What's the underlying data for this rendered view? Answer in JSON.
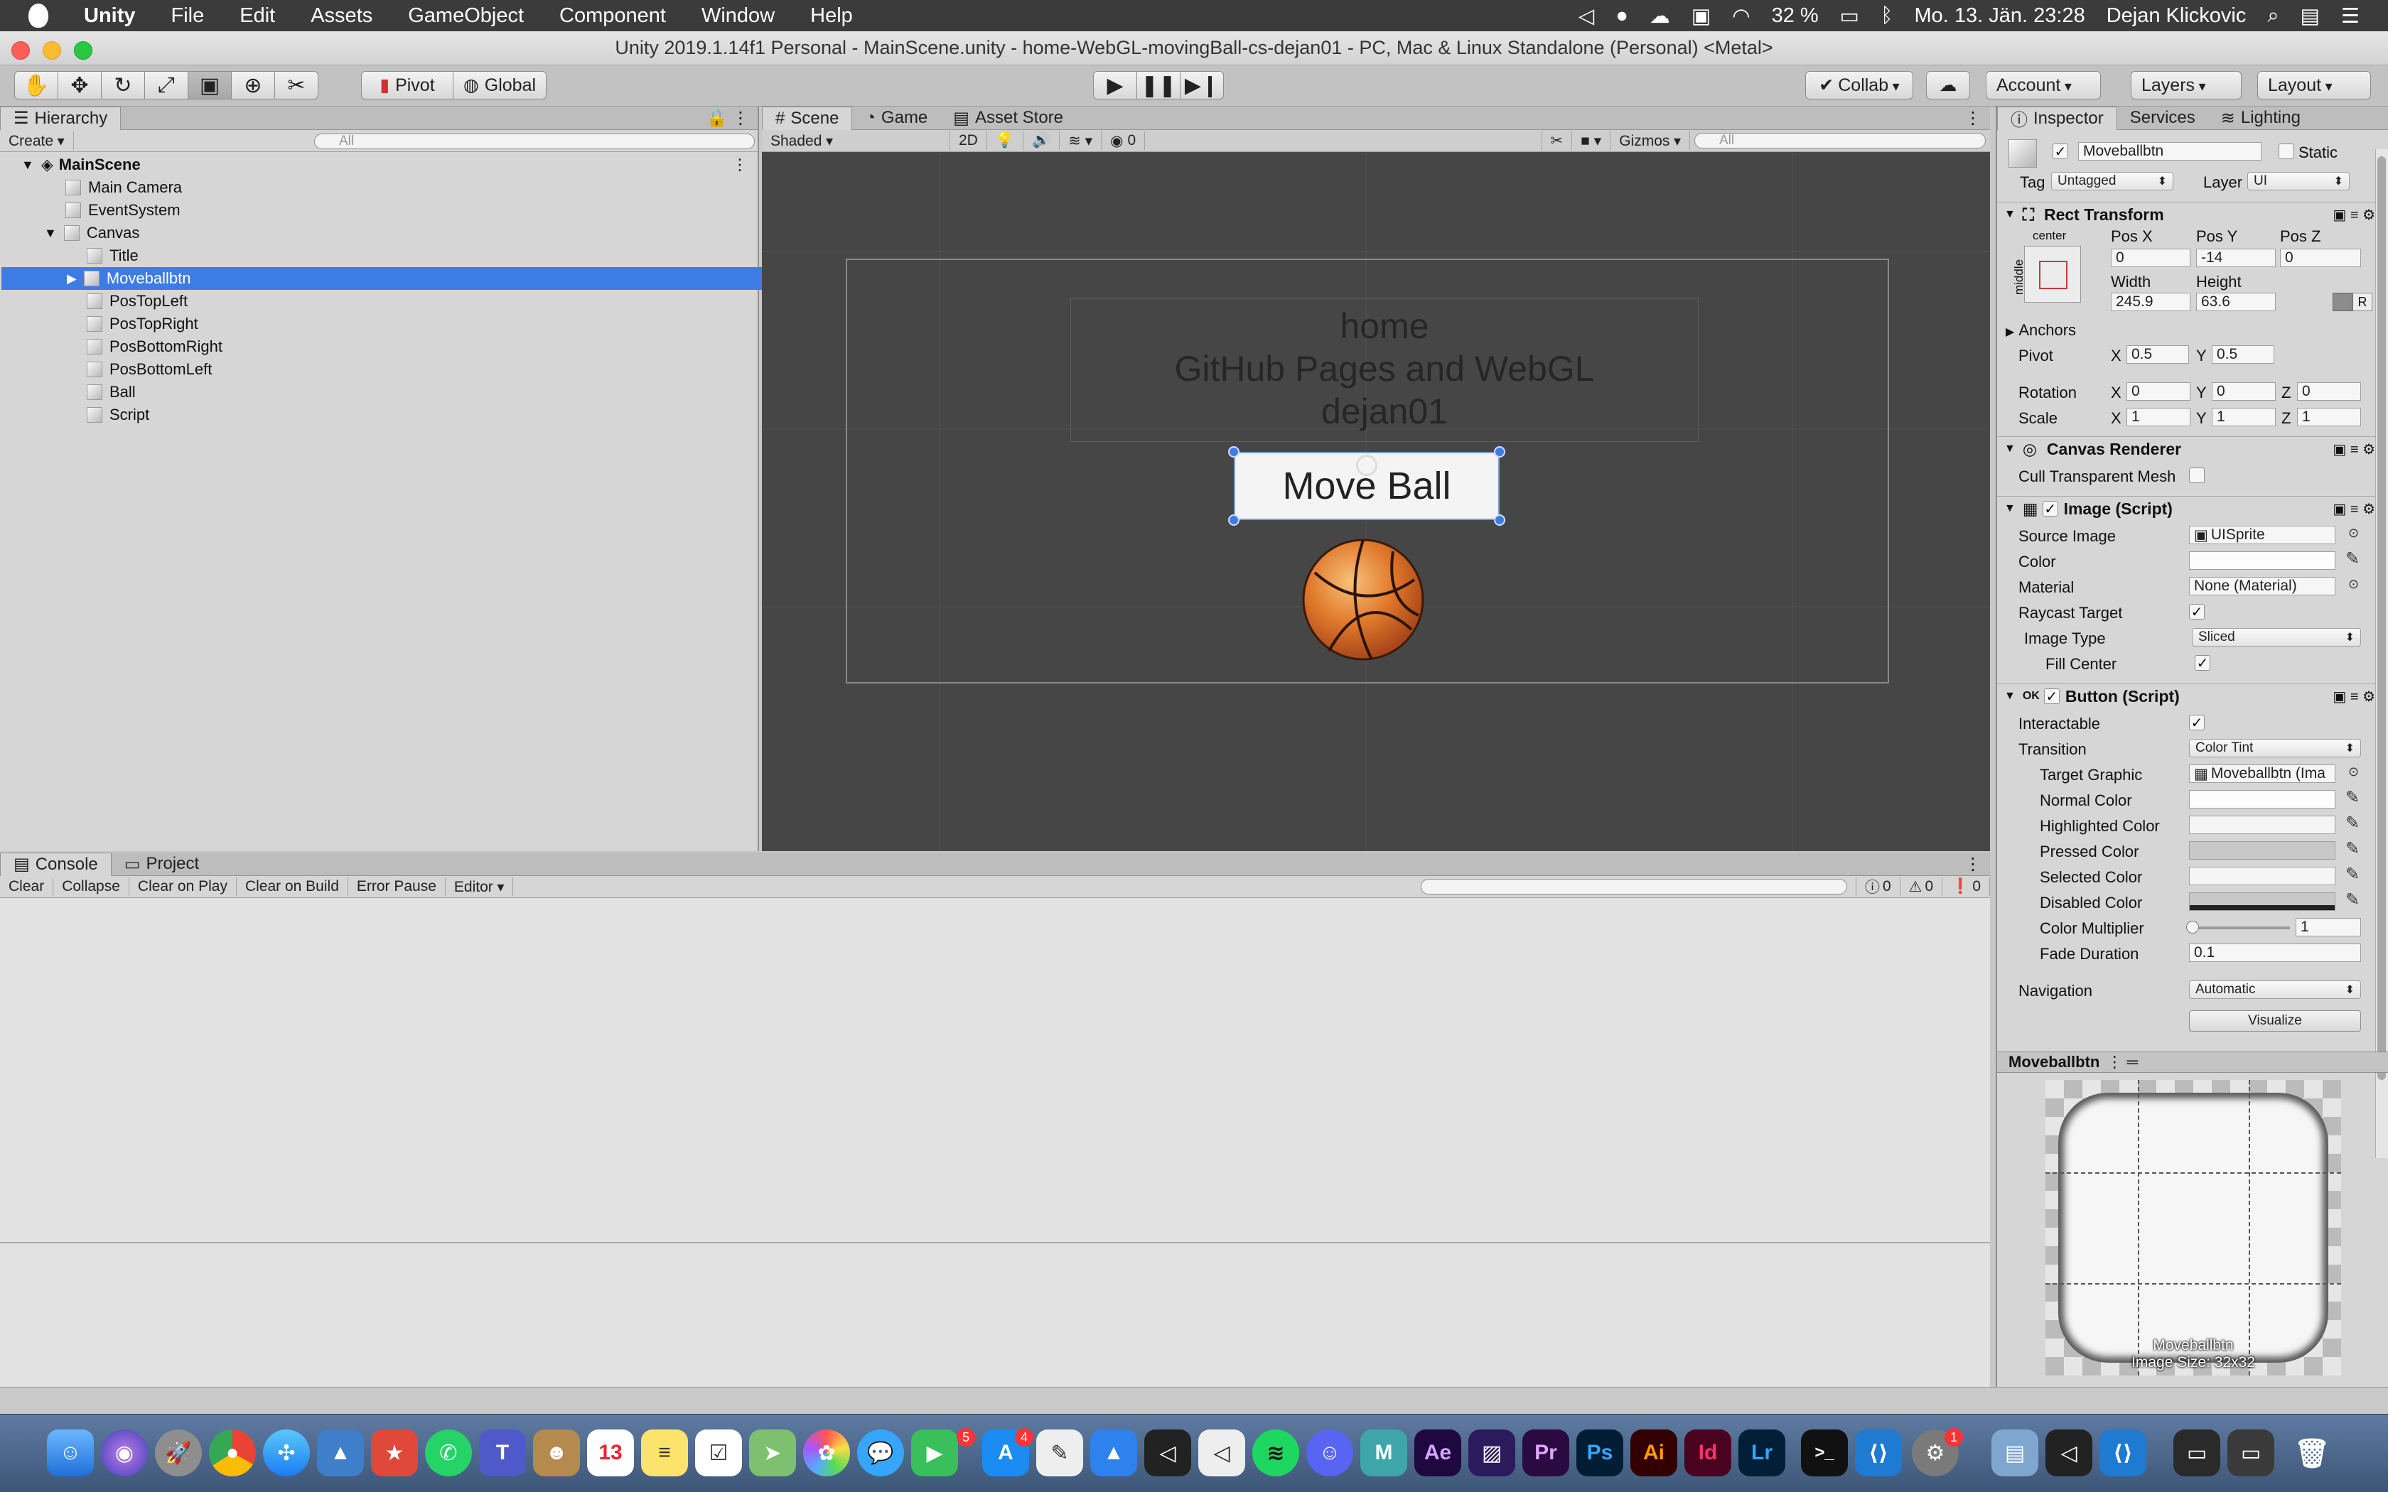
{
  "menubar": {
    "app": "Unity",
    "items": [
      "File",
      "Edit",
      "Assets",
      "GameObject",
      "Component",
      "Window",
      "Help"
    ],
    "battery": "32 %",
    "clock": "Mo. 13. Jän. 23:28",
    "user": "Dejan Klickovic"
  },
  "window": {
    "title": "Unity 2019.1.14f1 Personal - MainScene.unity - home-WebGL-movingBall-cs-dejan01 - PC, Mac & Linux Standalone (Personal) <Metal>"
  },
  "toolbar": {
    "pivot": "Pivot",
    "global": "Global",
    "collab": "Collab",
    "account": "Account",
    "layers": "Layers",
    "layout": "Layout"
  },
  "hierarchy": {
    "tab": "Hierarchy",
    "create": "Create",
    "search_placeholder": "All",
    "scene": "MainScene",
    "items": [
      "Main Camera",
      "EventSystem",
      "Canvas",
      "Title",
      "Moveballbtn",
      "PosTopLeft",
      "PosTopRight",
      "PosBottomRight",
      "PosBottomLeft",
      "Ball",
      "Script"
    ]
  },
  "scene": {
    "tabs": [
      "Scene",
      "Game",
      "Asset Store"
    ],
    "shading": "Shaded",
    "mode2d": "2D",
    "hidden_count": "0",
    "gizmos": "Gizmos",
    "search_placeholder": "All",
    "title_lines": [
      "home",
      "GitHub Pages and WebGL",
      "dejan01"
    ],
    "button_text": "Move Ball"
  },
  "console": {
    "tabs": [
      "Console",
      "Project"
    ],
    "buttons": [
      "Clear",
      "Collapse",
      "Clear on Play",
      "Clear on Build",
      "Error Pause",
      "Editor"
    ],
    "counts": [
      "0",
      "0",
      "0"
    ]
  },
  "inspector": {
    "tabs": [
      "Inspector",
      "Services",
      "Lighting"
    ],
    "object_name": "Moveballbtn",
    "static": "Static",
    "tag_label": "Tag",
    "tag": "Untagged",
    "layer_label": "Layer",
    "layer": "UI",
    "rect": {
      "title": "Rect Transform",
      "anchor_h": "center",
      "anchor_v": "middle",
      "posx_label": "Pos X",
      "posy_label": "Pos Y",
      "posz_label": "Pos Z",
      "posx": "0",
      "posy": "-14",
      "posz": "0",
      "width_label": "Width",
      "height_label": "Height",
      "width": "245.9",
      "height": "63.6",
      "r": "R",
      "anchors": "Anchors",
      "pivot_label": "Pivot",
      "pivot_x": "0.5",
      "pivot_y": "0.5",
      "rotation_label": "Rotation",
      "rot_x": "0",
      "rot_y": "0",
      "rot_z": "0",
      "scale_label": "Scale",
      "scale_x": "1",
      "scale_y": "1",
      "scale_z": "1",
      "x": "X",
      "y": "Y",
      "z": "Z"
    },
    "canvas_renderer": {
      "title": "Canvas Renderer",
      "cull": "Cull Transparent Mesh"
    },
    "image": {
      "title": "Image (Script)",
      "source_label": "Source Image",
      "source": "UISprite",
      "color_label": "Color",
      "material_label": "Material",
      "material": "None (Material)",
      "raycast_label": "Raycast Target",
      "type_label": "Image Type",
      "type": "Sliced",
      "fill_label": "Fill Center"
    },
    "button": {
      "title": "Button (Script)",
      "interactable_label": "Interactable",
      "transition_label": "Transition",
      "transition": "Color Tint",
      "target_label": "Target Graphic",
      "target": "Moveballbtn (Ima",
      "normal": "Normal Color",
      "highlighted": "Highlighted Color",
      "pressed": "Pressed Color",
      "selected": "Selected Color",
      "disabled": "Disabled Color",
      "multiplier_label": "Color Multiplier",
      "multiplier": "1",
      "fade_label": "Fade Duration",
      "fade": "0.1",
      "navigation_label": "Navigation",
      "navigation": "Automatic",
      "visualize": "Visualize"
    },
    "preview": {
      "title": "Moveballbtn",
      "caption1": "Moveballbtn",
      "caption2": "Image Size: 32x32"
    }
  },
  "dock": {
    "badges": [
      "5",
      "4",
      "1"
    ],
    "labels": [
      "Ae",
      "Pr",
      "Ps",
      "Ai",
      "Id",
      "Lr",
      "13"
    ]
  },
  "colors": {
    "selection": "#3e7ce5",
    "scene_bg": "#464646",
    "panel": "#d6d6d6",
    "ball": "#e0782a"
  }
}
